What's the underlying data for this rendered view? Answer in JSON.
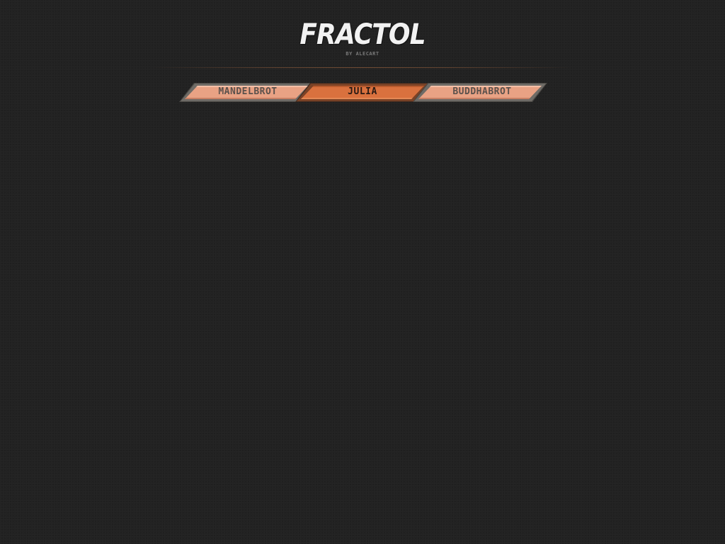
{
  "header": {
    "title": "FRACTOL",
    "byline": "BY ALECART"
  },
  "tabs": [
    {
      "label": "MANDELBROT",
      "active": false
    },
    {
      "label": "JULIA",
      "active": true
    },
    {
      "label": "BUDDHABROT",
      "active": false
    }
  ],
  "colors": {
    "background": "#222222",
    "tab_inactive_fill": "#e9a284",
    "tab_active_fill": "#d9713e",
    "tab_frame": "#5c5a56",
    "tab_text_inactive": "#5b514c",
    "tab_text_active": "#2a1a14",
    "logo_text": "#f2f2f2"
  }
}
